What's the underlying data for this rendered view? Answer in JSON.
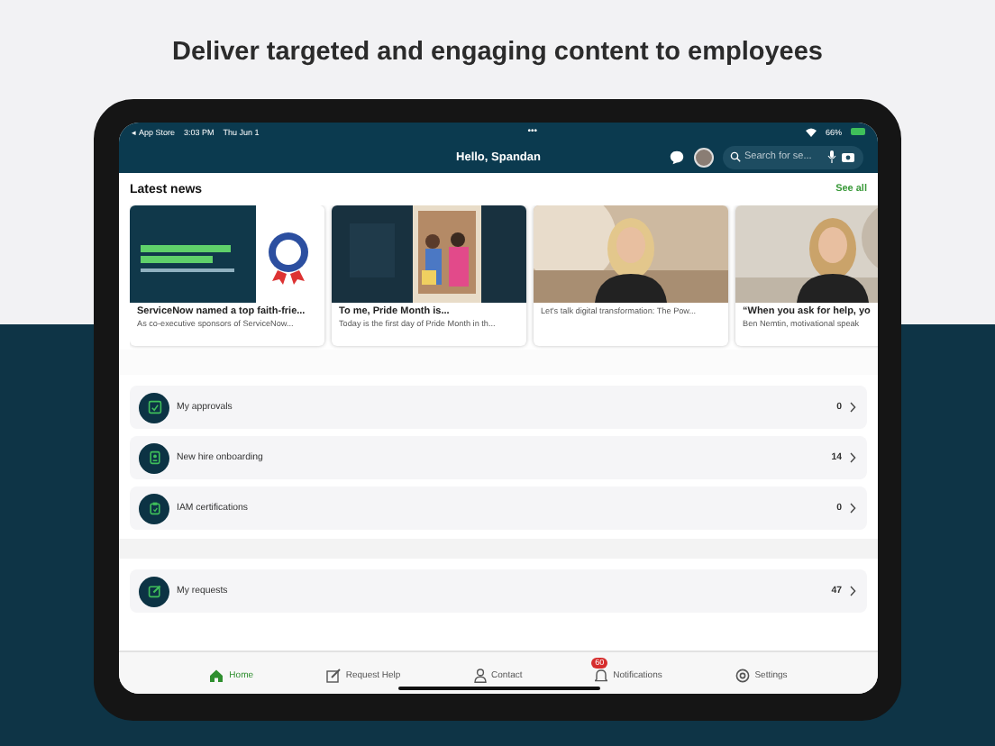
{
  "headline": "Deliver targeted and engaging content to employees",
  "status_bar": {
    "back": "◂ App Store",
    "time": "3:03 PM",
    "date": "Thu Jun 1",
    "dots": "•••",
    "battery": "66%"
  },
  "header": {
    "title": "Hello, Spandan",
    "search": {
      "placeholder": "Search for se..."
    }
  },
  "news": {
    "title": "Latest news",
    "link": "See all",
    "cards": [
      {
        "kind": "slide",
        "title": "ServiceNow named a top faith-frie...",
        "subtitle": "As co-executive sponsors of ServiceNow..."
      },
      {
        "title": "To me, Pride Month is...",
        "subtitle": "Today is the first day of Pride Month in th..."
      },
      {
        "kind": "video",
        "subtitle": "Let's talk digital transformation: The Pow..."
      },
      {
        "kind": "video",
        "title": "“When you ask for help, yo",
        "subtitle": "Ben Nemtin, motivational speak"
      }
    ]
  },
  "sections": [
    {
      "items": [
        {
          "label": "My approvals",
          "count": "0"
        },
        {
          "label": "New hire onboarding",
          "count": "14"
        },
        {
          "label": "IAM certifications",
          "count": "0"
        }
      ]
    },
    {
      "items": [
        {
          "label": "My requests",
          "count": "47"
        }
      ]
    }
  ],
  "tabs": [
    {
      "label": "Home",
      "selected": true
    },
    {
      "label": "Request Help",
      "selected": false
    },
    {
      "label": "Contact",
      "selected": false
    },
    {
      "label": "Notifications",
      "selected": false,
      "badge": "60"
    },
    {
      "label": "Settings",
      "selected": false
    }
  ]
}
